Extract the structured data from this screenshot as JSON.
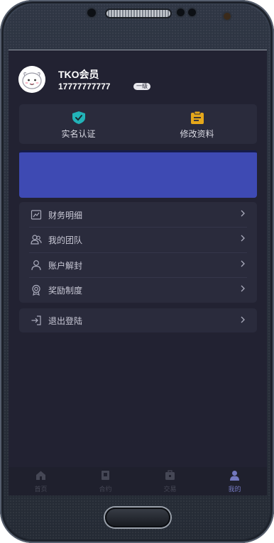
{
  "profile": {
    "username": "TKO会员",
    "phone": "17777777777",
    "level_badge": "一级"
  },
  "quick_actions": [
    {
      "label": "实名认证",
      "icon": "verified-shield-icon",
      "color": "#22b3b8"
    },
    {
      "label": "修改资料",
      "icon": "edit-profile-clipboard-icon",
      "color": "#e5a71b"
    }
  ],
  "menu": [
    {
      "label": "财务明细",
      "icon": "chart-icon"
    },
    {
      "label": "我的团队",
      "icon": "team-icon"
    },
    {
      "label": "账户解封",
      "icon": "user-icon"
    },
    {
      "label": "奖励制度",
      "icon": "award-icon"
    }
  ],
  "logout": {
    "label": "退出登陆",
    "icon": "logout-icon"
  },
  "tabs": [
    {
      "label": "首页",
      "icon": "home-icon"
    },
    {
      "label": "合约",
      "icon": "contract-icon"
    },
    {
      "label": "交易",
      "icon": "trade-icon"
    },
    {
      "label": "我的",
      "icon": "profile-icon",
      "active": true
    }
  ],
  "colors": {
    "background": "#222232",
    "card": "#2a2b3c",
    "banner": "#3e4ab3",
    "accent": "#9aa0ff"
  }
}
